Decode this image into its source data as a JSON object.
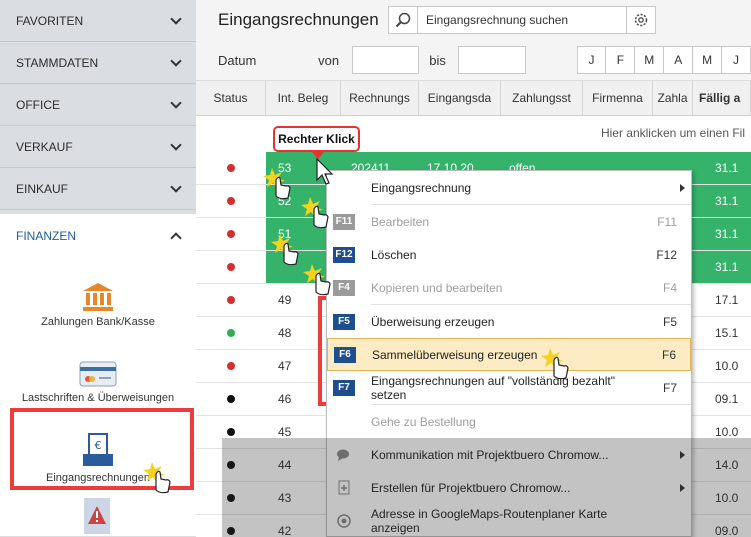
{
  "sidebar": {
    "sections": [
      "FAVORITEN",
      "STAMMDATEN",
      "OFFICE",
      "VERKAUF",
      "EINKAUF"
    ],
    "finance_title": "FINANZEN",
    "finance_items": [
      "Zahlungen Bank/Kasse",
      "Lastschriften & Überweisungen",
      "Eingangsrechnungen"
    ]
  },
  "header": {
    "title": "Eingangsrechnungen",
    "search_placeholder": "Eingangsrechnung suchen"
  },
  "filter": {
    "label": "Datum",
    "from": "von",
    "to": "bis",
    "months": [
      "J",
      "F",
      "M",
      "A",
      "M",
      "J"
    ]
  },
  "table": {
    "columns": [
      "Status",
      "Int. Beleg",
      "Rechnungs",
      "Eingangsda",
      "Zahlungsst",
      "Firmenna",
      "Zahla",
      "Fällig a"
    ],
    "hint": "Hier anklicken um einen Fil",
    "rows": [
      {
        "status": "#d32f2f",
        "beleg": "53",
        "rnr": "202411",
        "datum": "17.10.20",
        "zahl": "offen",
        "faellig": "31.1",
        "selected": true
      },
      {
        "status": "#d32f2f",
        "beleg": "52",
        "rnr": "",
        "datum": "",
        "zahl": "",
        "faellig": "31.1",
        "selected": true
      },
      {
        "status": "#d32f2f",
        "beleg": "51",
        "rnr": "",
        "datum": "",
        "zahl": "",
        "faellig": "31.1",
        "selected": true
      },
      {
        "status": "#d32f2f",
        "beleg": "",
        "rnr": "",
        "datum": "",
        "zahl": "",
        "faellig": "31.1",
        "selected": true
      },
      {
        "status": "#d32f2f",
        "beleg": "49",
        "rnr": "",
        "datum": "",
        "zahl": "",
        "faellig": "17.1",
        "selected": false
      },
      {
        "status": "#2fae5a",
        "beleg": "48",
        "rnr": "",
        "datum": "",
        "zahl": "",
        "faellig": "15.1",
        "selected": false
      },
      {
        "status": "#d32f2f",
        "beleg": "47",
        "rnr": "",
        "datum": "",
        "zahl": "",
        "faellig": "10.0",
        "selected": false
      },
      {
        "status": "#111111",
        "beleg": "46",
        "rnr": "",
        "datum": "",
        "zahl": "",
        "faellig": "09.1",
        "selected": false
      },
      {
        "status": "#111111",
        "beleg": "45",
        "rnr": "",
        "datum": "",
        "zahl": "",
        "faellig": "10.0",
        "selected": false
      },
      {
        "status": "#111111",
        "beleg": "44",
        "rnr": "",
        "datum": "",
        "zahl": "",
        "faellig": "14.0",
        "selected": false
      },
      {
        "status": "#111111",
        "beleg": "43",
        "rnr": "",
        "datum": "",
        "zahl": "",
        "faellig": "10.0",
        "selected": false
      },
      {
        "status": "#111111",
        "beleg": "42",
        "rnr": "",
        "datum": "",
        "zahl": "",
        "faellig": "09.0",
        "selected": false
      }
    ]
  },
  "tooltip": "Rechter Klick",
  "context_menu": [
    {
      "key": "",
      "label": "Eingangsrechnung",
      "shortcut": "",
      "submenu": true,
      "disabled": false,
      "icon": "none"
    },
    {
      "key": "F11",
      "label": "Bearbeiten",
      "shortcut": "F11",
      "submenu": false,
      "disabled": true,
      "icon": "grey"
    },
    {
      "key": "F12",
      "label": "Löschen",
      "shortcut": "F12",
      "submenu": false,
      "disabled": false,
      "icon": "blue"
    },
    {
      "key": "F4",
      "label": "Kopieren und bearbeiten",
      "shortcut": "F4",
      "submenu": false,
      "disabled": true,
      "icon": "grey"
    },
    {
      "key": "F5",
      "label": "Überweisung erzeugen",
      "shortcut": "F5",
      "submenu": false,
      "disabled": false,
      "icon": "blue"
    },
    {
      "key": "F6",
      "label": "Sammelüberweisung erzeugen",
      "shortcut": "F6",
      "submenu": false,
      "disabled": false,
      "icon": "blue",
      "highlight": true
    },
    {
      "key": "F7",
      "label": "Eingangsrechnungen auf \"vollständig bezahlt\" setzen",
      "shortcut": "F7",
      "submenu": false,
      "disabled": false,
      "icon": "blue"
    },
    {
      "key": "",
      "label": "Gehe zu Bestellung",
      "shortcut": "",
      "submenu": false,
      "disabled": true,
      "icon": "none"
    },
    {
      "key": "",
      "label": "Kommunikation mit Projektbuero Chromow...",
      "shortcut": "",
      "submenu": true,
      "disabled": false,
      "icon": "chat-icon"
    },
    {
      "key": "",
      "label": "Erstellen für Projektbuero Chromow...",
      "shortcut": "",
      "submenu": true,
      "disabled": false,
      "icon": "document-add-icon"
    },
    {
      "key": "",
      "label": "Adresse in GoogleMaps-Routenplaner Karte anzeigen",
      "shortcut": "",
      "submenu": false,
      "disabled": false,
      "icon": "map-pin-icon"
    }
  ],
  "colors": {
    "selected_row": "#35b36b",
    "highlight_box": "#ee3b3b",
    "menu_key_blue": "#1f4e8c"
  }
}
